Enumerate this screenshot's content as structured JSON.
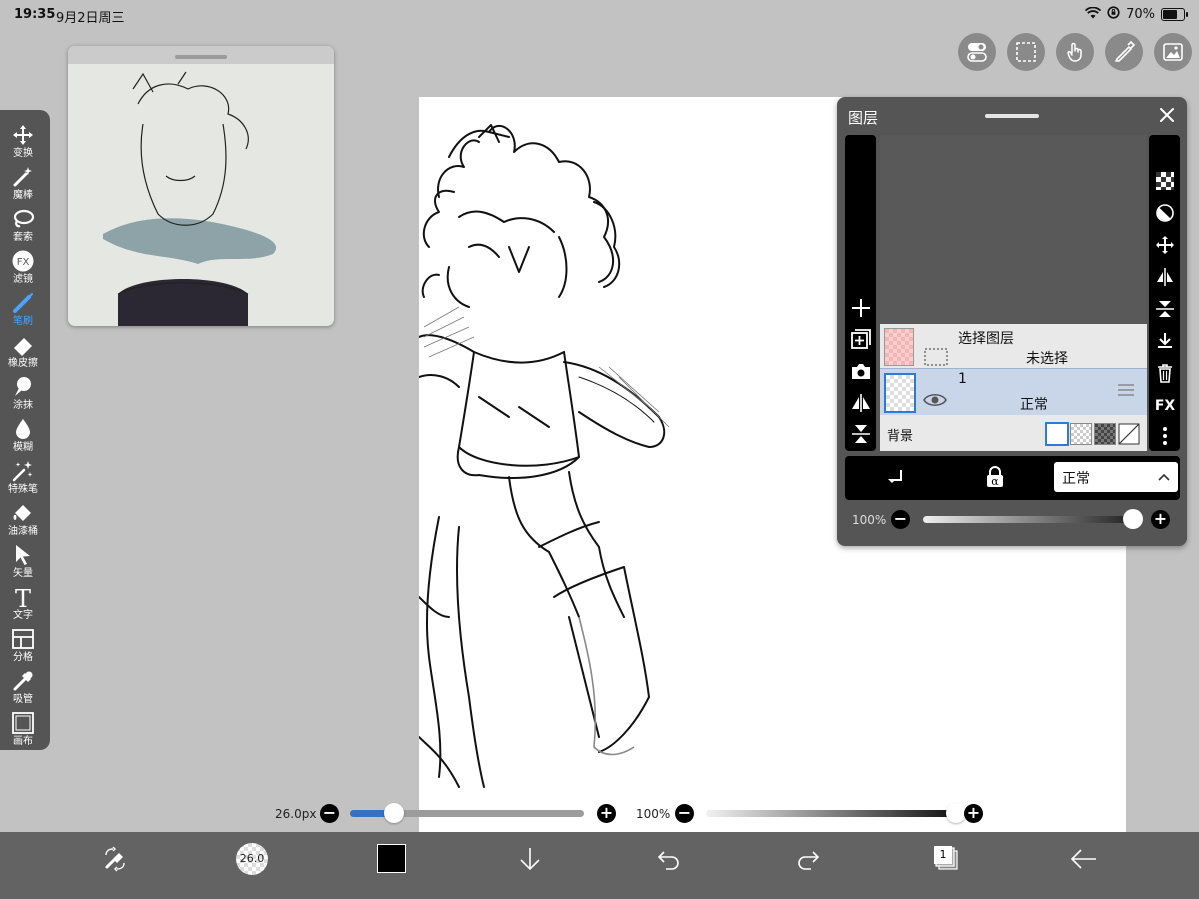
{
  "status_bar": {
    "time": "19:35",
    "date": "9月2日周三",
    "battery": "70%"
  },
  "tools": [
    {
      "label": "变换",
      "icon": "move-icon"
    },
    {
      "label": "魔棒",
      "icon": "magic-wand-icon"
    },
    {
      "label": "套索",
      "icon": "lasso-icon"
    },
    {
      "label": "滤镜",
      "icon": "fx-icon",
      "icon_text": "FX"
    },
    {
      "label": "笔刷",
      "icon": "brush-icon",
      "active": true
    },
    {
      "label": "橡皮擦",
      "icon": "eraser-icon"
    },
    {
      "label": "涂抹",
      "icon": "smudge-icon"
    },
    {
      "label": "模糊",
      "icon": "blur-drop-icon"
    },
    {
      "label": "特殊笔",
      "icon": "special-pen-icon"
    },
    {
      "label": "油漆桶",
      "icon": "paint-bucket-icon"
    },
    {
      "label": "矢量",
      "icon": "vector-arrow-icon"
    },
    {
      "label": "文字",
      "icon": "text-icon",
      "icon_text": "T"
    },
    {
      "label": "分格",
      "icon": "frame-divider-icon"
    },
    {
      "label": "吸管",
      "icon": "eyedropper-icon"
    },
    {
      "label": "画布",
      "icon": "canvas-icon"
    }
  ],
  "top_right_buttons": [
    "toggle-icon",
    "selection-icon",
    "touch-icon",
    "ruler-pen-icon",
    "image-icon"
  ],
  "layers_panel": {
    "title": "图层",
    "selection_layer": {
      "name": "选择图层",
      "status": "未选择"
    },
    "layer1": {
      "name": "1",
      "blend": "正常"
    },
    "background_label": "背景",
    "blend_mode": "正常",
    "opacity": "100%",
    "opacity_fraction": 1.0
  },
  "brush_size": {
    "label": "26.0px",
    "fraction": 0.19
  },
  "brush_opacity": {
    "label": "100%",
    "fraction": 1.0
  },
  "bottom_bar": {
    "brush_size_text": "26.0",
    "layer_count": "1",
    "current_color": "#000000"
  }
}
